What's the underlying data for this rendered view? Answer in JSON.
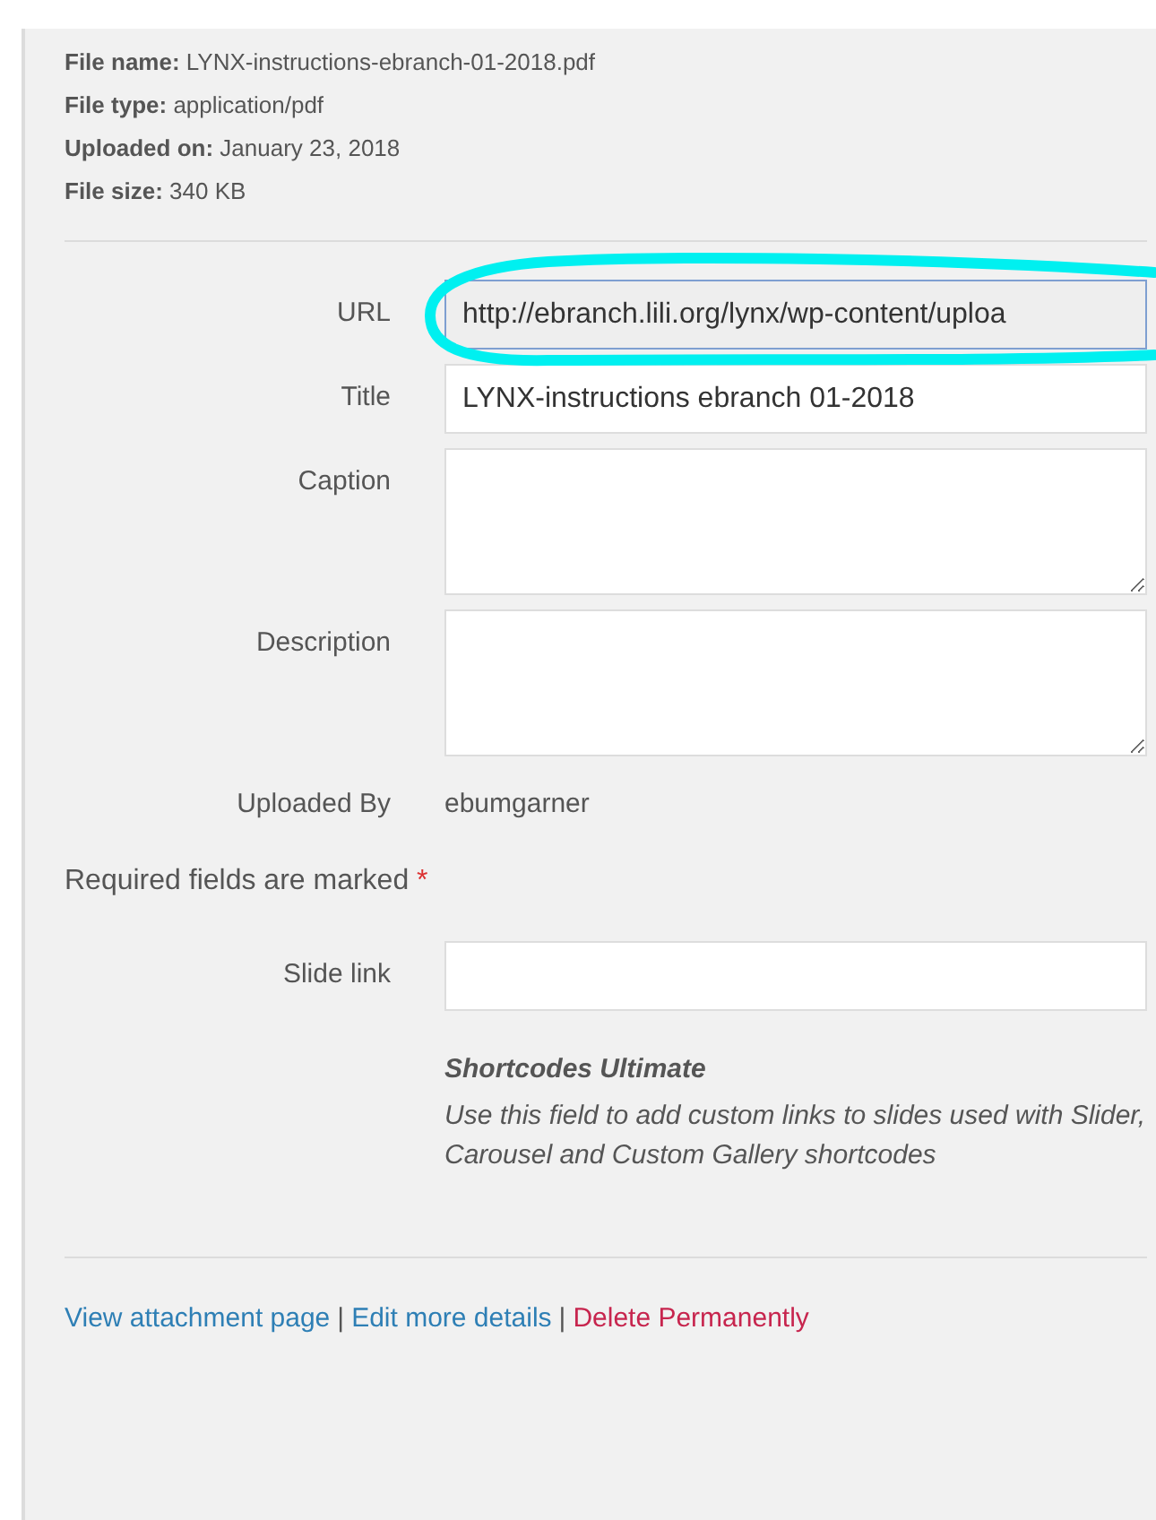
{
  "file_info": [
    {
      "label": "File name:",
      "value": "LYNX-instructions-ebranch-01-2018.pdf"
    },
    {
      "label": "File type:",
      "value": "application/pdf"
    },
    {
      "label": "Uploaded on:",
      "value": "January 23, 2018"
    },
    {
      "label": "File size:",
      "value": "340 KB"
    }
  ],
  "fields": [
    {
      "kind": "input",
      "label": "URL",
      "value": "http://ebranch.lili.org/lynx/wp-content/uploa",
      "readonly": true
    },
    {
      "kind": "input",
      "label": "Title",
      "value": "LYNX-instructions ebranch 01-2018",
      "readonly": false
    },
    {
      "kind": "textarea",
      "label": "Caption"
    },
    {
      "kind": "textarea",
      "label": "Description"
    },
    {
      "kind": "text",
      "label": "Uploaded By",
      "value": "ebumgarner"
    }
  ],
  "required_note": {
    "text": "Required fields are marked",
    "mark": "*"
  },
  "slide_link": {
    "label": "Slide link"
  },
  "help": {
    "title": "Shortcodes Ultimate",
    "text": "Use this field to add custom links to slides used with Slider, Carousel and Custom Gallery shortcodes"
  },
  "actions": [
    {
      "label": "View attachment page",
      "kind": "link"
    },
    {
      "label": "Edit more details",
      "kind": "link"
    },
    {
      "label": "Delete Permanently",
      "kind": "delete"
    }
  ],
  "separator": "|",
  "annotation": {
    "kind": "loop"
  }
}
